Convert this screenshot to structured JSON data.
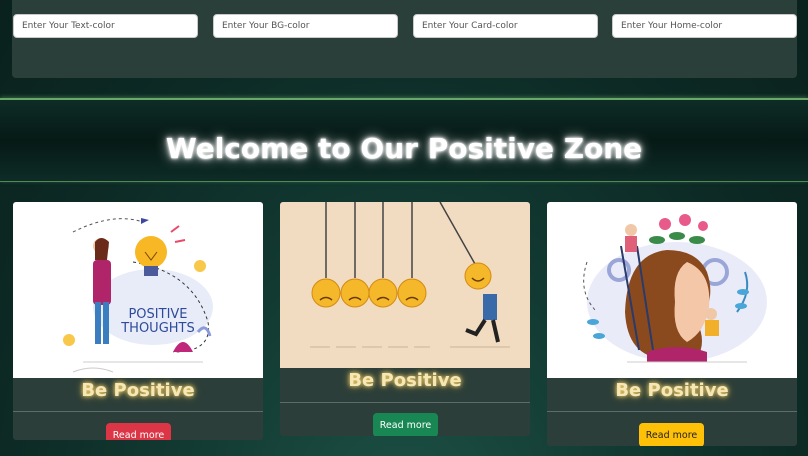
{
  "inputs": {
    "text_color_placeholder": "Enter Your Text-color",
    "bg_color_placeholder": "Enter Your BG-color",
    "card_color_placeholder": "Enter Your Card-color",
    "home_color_placeholder": "Enter Your Home-color"
  },
  "hero": {
    "title": "Welcome to Our Positive Zone"
  },
  "cards": [
    {
      "title": "Be Positive",
      "button": "Read more",
      "button_color": "#dc3545",
      "illustration_text": "POSITIVE THOUGHTS"
    },
    {
      "title": "Be Positive",
      "button": "Read more",
      "button_color": "#198754"
    },
    {
      "title": "Be Positive",
      "button": "Read more",
      "button_color": "#ffc107"
    }
  ]
}
